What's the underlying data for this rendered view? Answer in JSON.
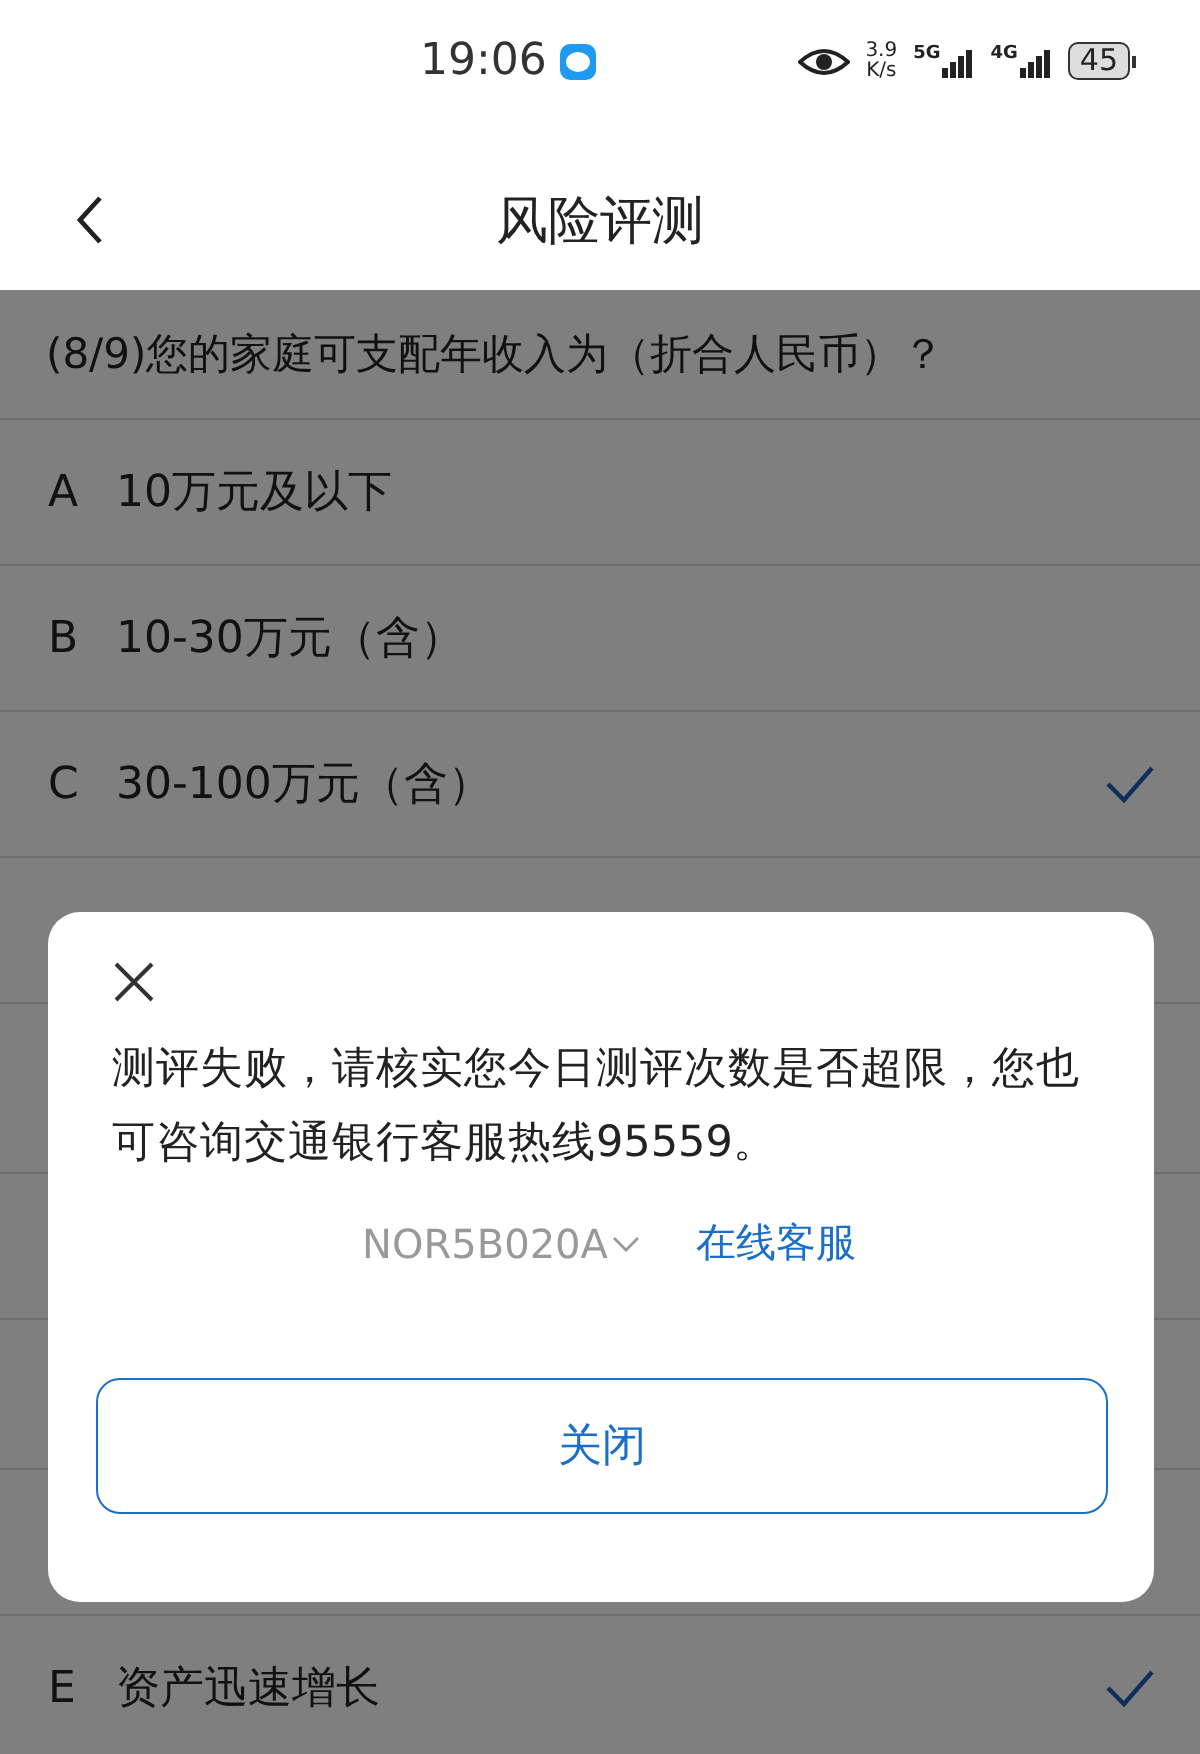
{
  "status_bar": {
    "time": "19:06",
    "speed_value": "3.9",
    "speed_unit": "K/s",
    "network_1": "5G",
    "network_2": "4G",
    "battery": "45"
  },
  "header": {
    "title": "风险评测"
  },
  "question": "(8/9)您的家庭可支配年收入为（折合人民币）？",
  "options": [
    {
      "letter": "A",
      "text": "10万元及以下",
      "selected": false
    },
    {
      "letter": "B",
      "text": "10-30万元（含）",
      "selected": false
    },
    {
      "letter": "C",
      "text": "30-100万元（含）",
      "selected": true
    }
  ],
  "lower_options": [
    {
      "letter": "E",
      "text": "资产迅速增长",
      "selected": true
    }
  ],
  "dialog": {
    "message": "测评失败，请核实您今日测评次数是否超限，您也可咨询交通银行客服热线95559。",
    "code": "NOR5B020A",
    "link": "在线客服",
    "button": "关闭"
  }
}
